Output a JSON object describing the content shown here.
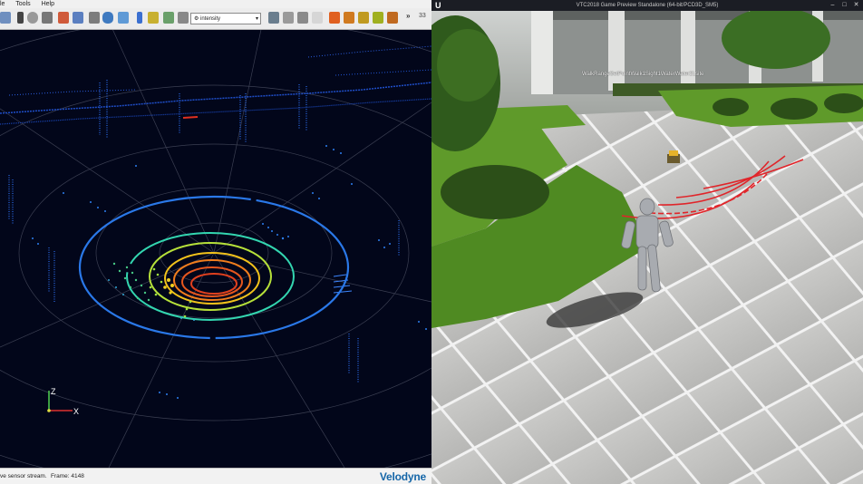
{
  "left_app": {
    "menu": [
      "le",
      "Tools",
      "Help"
    ],
    "color_by": {
      "selected": "intensity",
      "glyph": "⚙"
    },
    "toolbar_overflow": "»",
    "extra_label": "33",
    "status": {
      "message": "ve sensor stream.",
      "frame_label": "Frame: 4148"
    },
    "brand": "Velodyne",
    "axes": {
      "z": "Z",
      "x": "X"
    }
  },
  "right_app": {
    "logo": "U",
    "window_title": "VTC2018 Game Preview Standalone (64-bit/PCD3D_SM5)",
    "window_buttons": {
      "minimize": "‒",
      "maximize": "□",
      "close": "✕"
    },
    "overlay_text": "WalkRangeSetPointWalk1Sight1WaterWater2Lsite"
  },
  "colors": {
    "viewport_bg": "#02061a",
    "accent_blue": "#1566a8",
    "ring_colors": [
      "#2d6ff0",
      "#33d6b0",
      "#b6e03a",
      "#f2c21b",
      "#f07d1d",
      "#e0401e"
    ]
  }
}
